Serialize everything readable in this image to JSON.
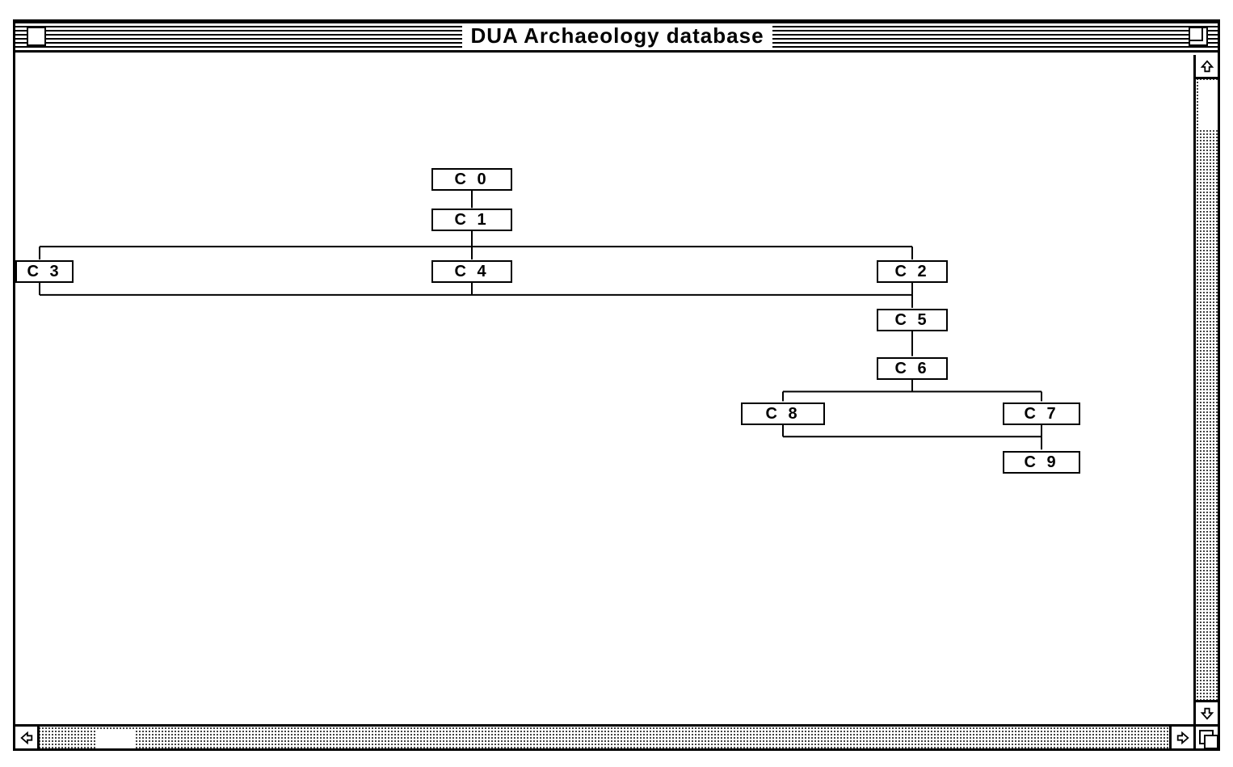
{
  "window": {
    "title": "DUA Archaeology database"
  },
  "nodes": {
    "c0": "C 0",
    "c1": "C 1",
    "c2": "C 2",
    "c3": "C 3",
    "c4": "C 4",
    "c5": "C 5",
    "c6": "C 6",
    "c7": "C 7",
    "c8": "C 8",
    "c9": "C 9"
  },
  "chart_data": {
    "type": "tree",
    "title": "DUA Archaeology database",
    "nodes": [
      "C0",
      "C1",
      "C2",
      "C3",
      "C4",
      "C5",
      "C6",
      "C7",
      "C8",
      "C9"
    ],
    "edges": [
      {
        "from": "C0",
        "to": "C1"
      },
      {
        "from": "C1",
        "to": "C3"
      },
      {
        "from": "C1",
        "to": "C4"
      },
      {
        "from": "C1",
        "to": "C2"
      },
      {
        "from": "C3",
        "to": "C5"
      },
      {
        "from": "C4",
        "to": "C5"
      },
      {
        "from": "C2",
        "to": "C5"
      },
      {
        "from": "C5",
        "to": "C6"
      },
      {
        "from": "C6",
        "to": "C8"
      },
      {
        "from": "C6",
        "to": "C7"
      },
      {
        "from": "C8",
        "to": "C9"
      },
      {
        "from": "C7",
        "to": "C9"
      }
    ]
  }
}
